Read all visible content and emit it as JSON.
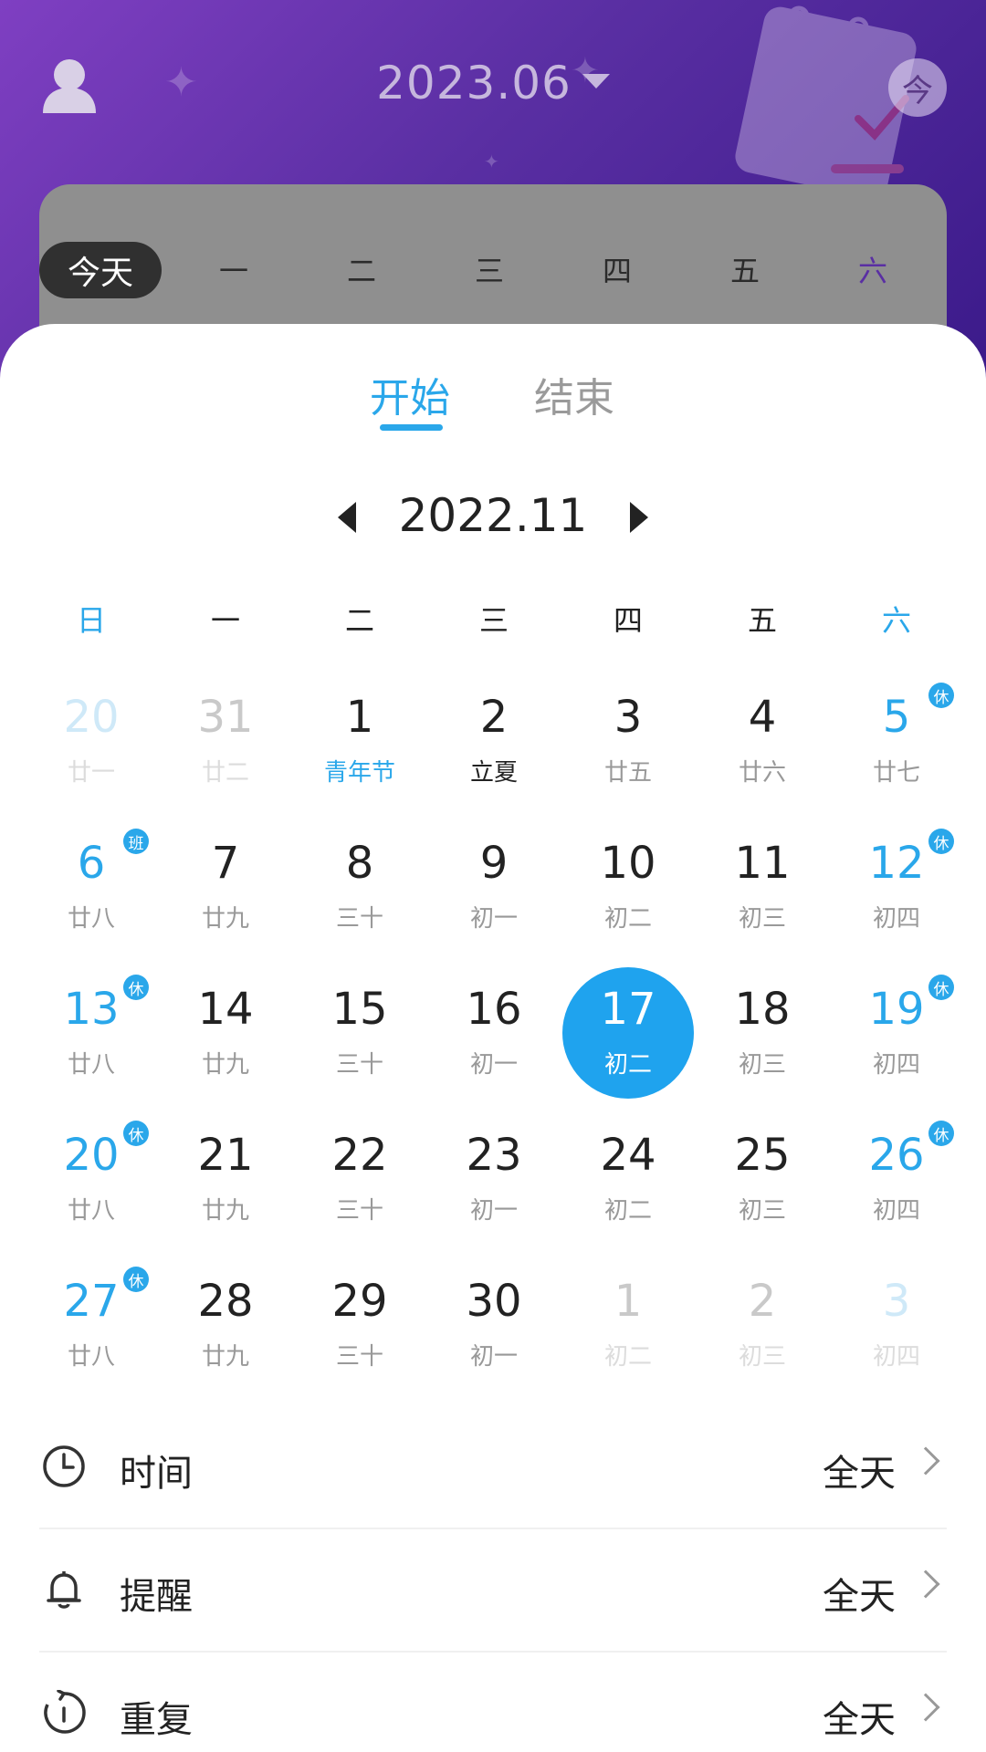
{
  "header": {
    "month_title": "2023.06",
    "today_button": "今"
  },
  "week_bar": {
    "today_pill": "今天",
    "days": [
      "一",
      "二",
      "三",
      "四",
      "五",
      "六"
    ]
  },
  "sheet": {
    "tabs": [
      "开始",
      "结束"
    ],
    "nav_month": "2022.11",
    "dow": [
      "日",
      "一",
      "二",
      "三",
      "四",
      "五",
      "六"
    ],
    "weeks": [
      [
        {
          "n": "20",
          "l": "廿一",
          "s": "fadedblue"
        },
        {
          "n": "31",
          "l": "廿二",
          "s": "faded"
        },
        {
          "n": "1",
          "l": "青年节",
          "s": "normal",
          "lb": "blue"
        },
        {
          "n": "2",
          "l": "立夏",
          "s": "normal",
          "lb": "dark"
        },
        {
          "n": "3",
          "l": "廿五",
          "s": "normal"
        },
        {
          "n": "4",
          "l": "廿六",
          "s": "normal"
        },
        {
          "n": "5",
          "l": "廿七",
          "s": "blue",
          "badge": "休"
        }
      ],
      [
        {
          "n": "6",
          "l": "廿八",
          "s": "blue",
          "badge": "班"
        },
        {
          "n": "7",
          "l": "廿九",
          "s": "normal"
        },
        {
          "n": "8",
          "l": "三十",
          "s": "normal"
        },
        {
          "n": "9",
          "l": "初一",
          "s": "normal"
        },
        {
          "n": "10",
          "l": "初二",
          "s": "normal"
        },
        {
          "n": "11",
          "l": "初三",
          "s": "normal"
        },
        {
          "n": "12",
          "l": "初四",
          "s": "blue",
          "badge": "休"
        }
      ],
      [
        {
          "n": "13",
          "l": "廿八",
          "s": "blue",
          "badge": "休"
        },
        {
          "n": "14",
          "l": "廿九",
          "s": "normal"
        },
        {
          "n": "15",
          "l": "三十",
          "s": "normal"
        },
        {
          "n": "16",
          "l": "初一",
          "s": "normal"
        },
        {
          "n": "17",
          "l": "初二",
          "s": "selected"
        },
        {
          "n": "18",
          "l": "初三",
          "s": "normal"
        },
        {
          "n": "19",
          "l": "初四",
          "s": "blue",
          "badge": "休"
        }
      ],
      [
        {
          "n": "20",
          "l": "廿八",
          "s": "blue",
          "badge": "休"
        },
        {
          "n": "21",
          "l": "廿九",
          "s": "normal"
        },
        {
          "n": "22",
          "l": "三十",
          "s": "normal"
        },
        {
          "n": "23",
          "l": "初一",
          "s": "normal"
        },
        {
          "n": "24",
          "l": "初二",
          "s": "normal"
        },
        {
          "n": "25",
          "l": "初三",
          "s": "normal"
        },
        {
          "n": "26",
          "l": "初四",
          "s": "blue",
          "badge": "休"
        }
      ],
      [
        {
          "n": "27",
          "l": "廿八",
          "s": "blue",
          "badge": "休"
        },
        {
          "n": "28",
          "l": "廿九",
          "s": "normal"
        },
        {
          "n": "29",
          "l": "三十",
          "s": "normal"
        },
        {
          "n": "30",
          "l": "初一",
          "s": "normal"
        },
        {
          "n": "1",
          "l": "初二",
          "s": "faded"
        },
        {
          "n": "2",
          "l": "初三",
          "s": "faded"
        },
        {
          "n": "3",
          "l": "初四",
          "s": "fadedblue"
        }
      ]
    ],
    "settings": [
      {
        "icon": "clock-icon",
        "label": "时间",
        "value": "全天"
      },
      {
        "icon": "bell-icon",
        "label": "提醒",
        "value": "全天"
      },
      {
        "icon": "repeat-icon",
        "label": "重复",
        "value": "全天"
      }
    ]
  },
  "colors": {
    "accent": "#2aa7ea",
    "selected": "#1fa3ee",
    "header_purple": "#5a2fa3"
  }
}
